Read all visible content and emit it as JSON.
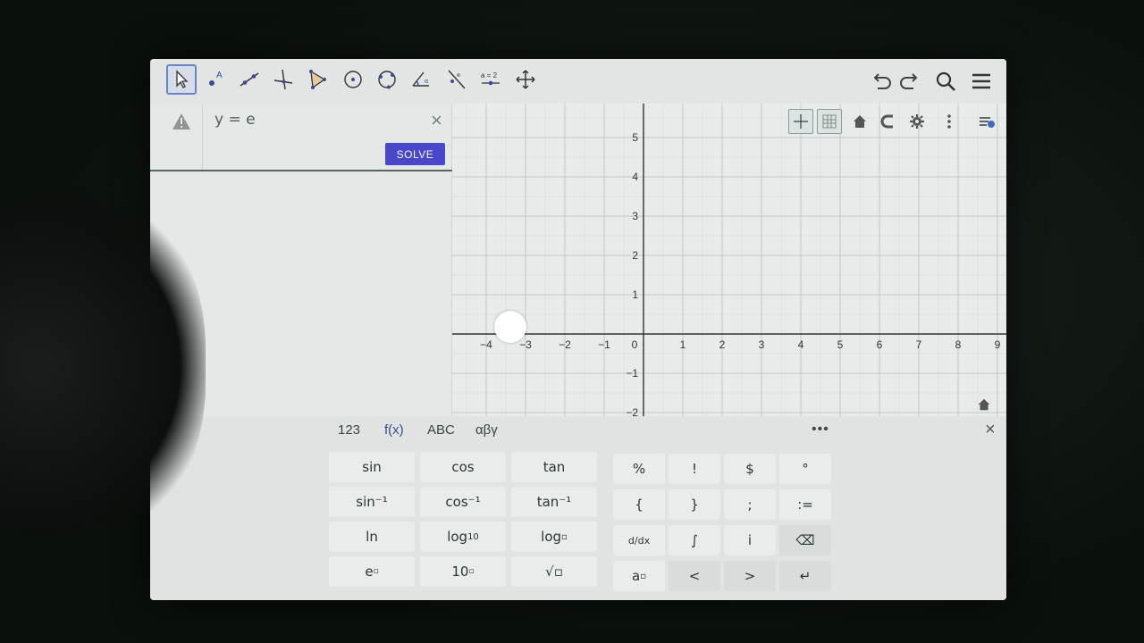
{
  "toolbar": {
    "tools": [
      "move-tool",
      "point-tool",
      "line-tool",
      "perpendicular-tool",
      "polygon-tool",
      "circle-center-tool",
      "circle-three-points-tool",
      "angle-tool",
      "reflect-tool",
      "slider-tool",
      "move-graphics-tool"
    ],
    "slider_label": "a = 2"
  },
  "algebra": {
    "input_value": "y = e",
    "solve_label": "SOLVE"
  },
  "graphics": {
    "x_ticks": [
      "−4",
      "−3",
      "−2",
      "−1",
      "0",
      "1",
      "2",
      "3",
      "4",
      "5",
      "6",
      "7",
      "8",
      "9"
    ],
    "y_ticks_pos": [
      "5",
      "4",
      "3",
      "2",
      "1"
    ],
    "y_ticks_neg": [
      "−1",
      "−2"
    ]
  },
  "keyboard": {
    "tabs": [
      "123",
      "f(x)",
      "ABC",
      "αβγ"
    ],
    "more_label": "•••",
    "close_label": "×",
    "func_keys": [
      [
        "sin",
        "cos",
        "tan"
      ],
      [
        "sin⁻¹",
        "cos⁻¹",
        "tan⁻¹"
      ],
      [
        "ln",
        "log",
        "log"
      ],
      [
        "e",
        "10",
        "√"
      ]
    ],
    "log10_sub": "10",
    "symbol_keys": [
      [
        "%",
        "!",
        "$",
        "°"
      ],
      [
        "{",
        "}",
        ";",
        ":="
      ],
      [
        "d/dx",
        "∫",
        "i",
        "⌫"
      ],
      [
        "a",
        "<",
        ">",
        "↵"
      ]
    ]
  },
  "colors": {
    "accent": "#4a48c8",
    "active_tab": "#3a4a8a",
    "screen_bg": "#e4e8e6"
  }
}
